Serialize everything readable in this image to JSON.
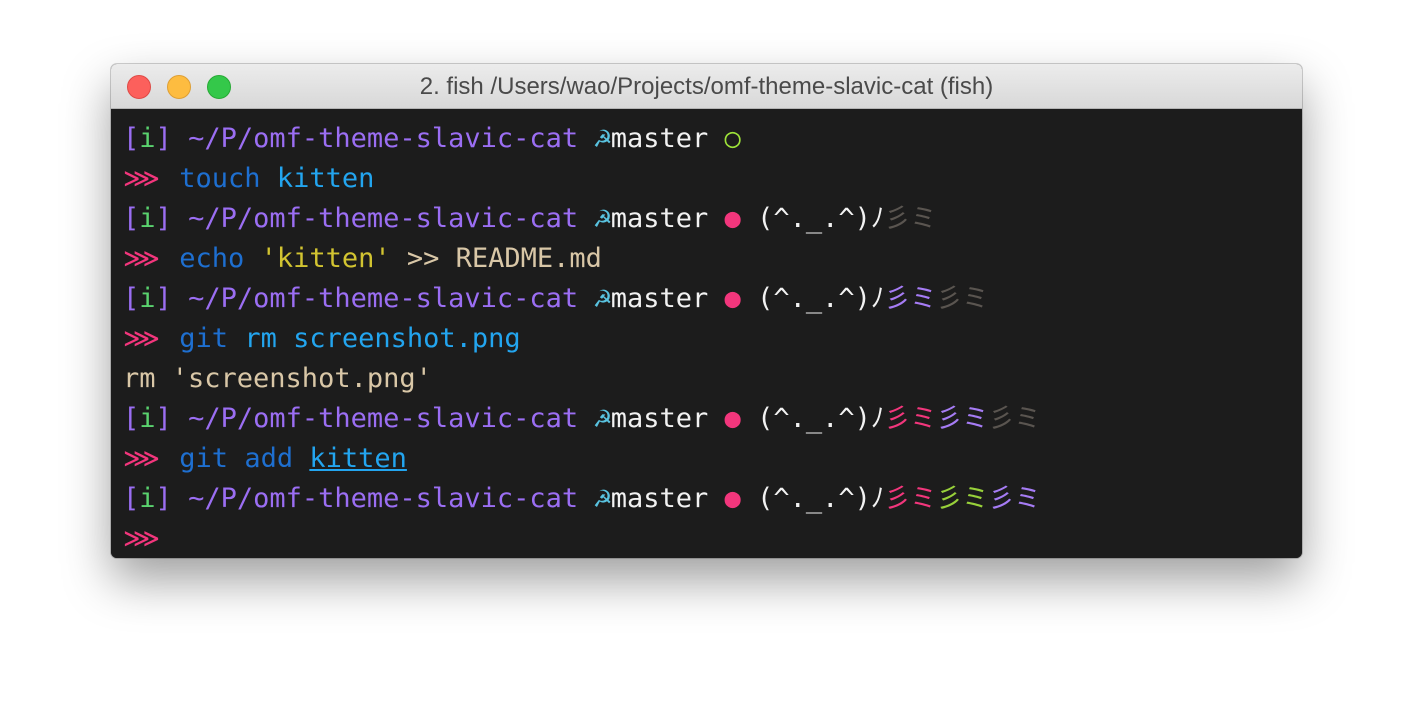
{
  "window": {
    "title": "2. fish  /Users/wao/Projects/omf-theme-slavic-cat (fish)"
  },
  "prompt": {
    "bracket_open": "[",
    "indicator": "i",
    "bracket_close": "]",
    "path": "~/P/omf-theme-slavic-cat",
    "vcs_icon": "☭",
    "branch": "master",
    "clean_mark": "○",
    "dirty_mark": "●",
    "cat_face": "(^._.^)ﾉ",
    "arrow": "⋙"
  },
  "commands": [
    {
      "cmd": "touch",
      "args": "kitten"
    },
    {
      "cmd": "echo",
      "string": "'kitten'",
      "rest": ">> README.md"
    },
    {
      "cmd": "git",
      "args": "rm screenshot.png"
    },
    {
      "cmd": "git",
      "sub": "add",
      "args": "kitten"
    }
  ],
  "output": {
    "rm_line": "rm 'screenshot.png'"
  },
  "lives": {
    "mark_a": "彡",
    "mark_b": "ミ"
  },
  "colors": {
    "background": "#1c1c1c",
    "path": "#9b6ef3",
    "indicator": "#5ad26e",
    "vcs_icon": "#59c3e0",
    "dirty": "#f2367c",
    "clean": "#9ee339",
    "command": "#1e6fd0",
    "argument": "#23a5ef",
    "string": "#d2c431",
    "text": "#d9c7a7"
  }
}
